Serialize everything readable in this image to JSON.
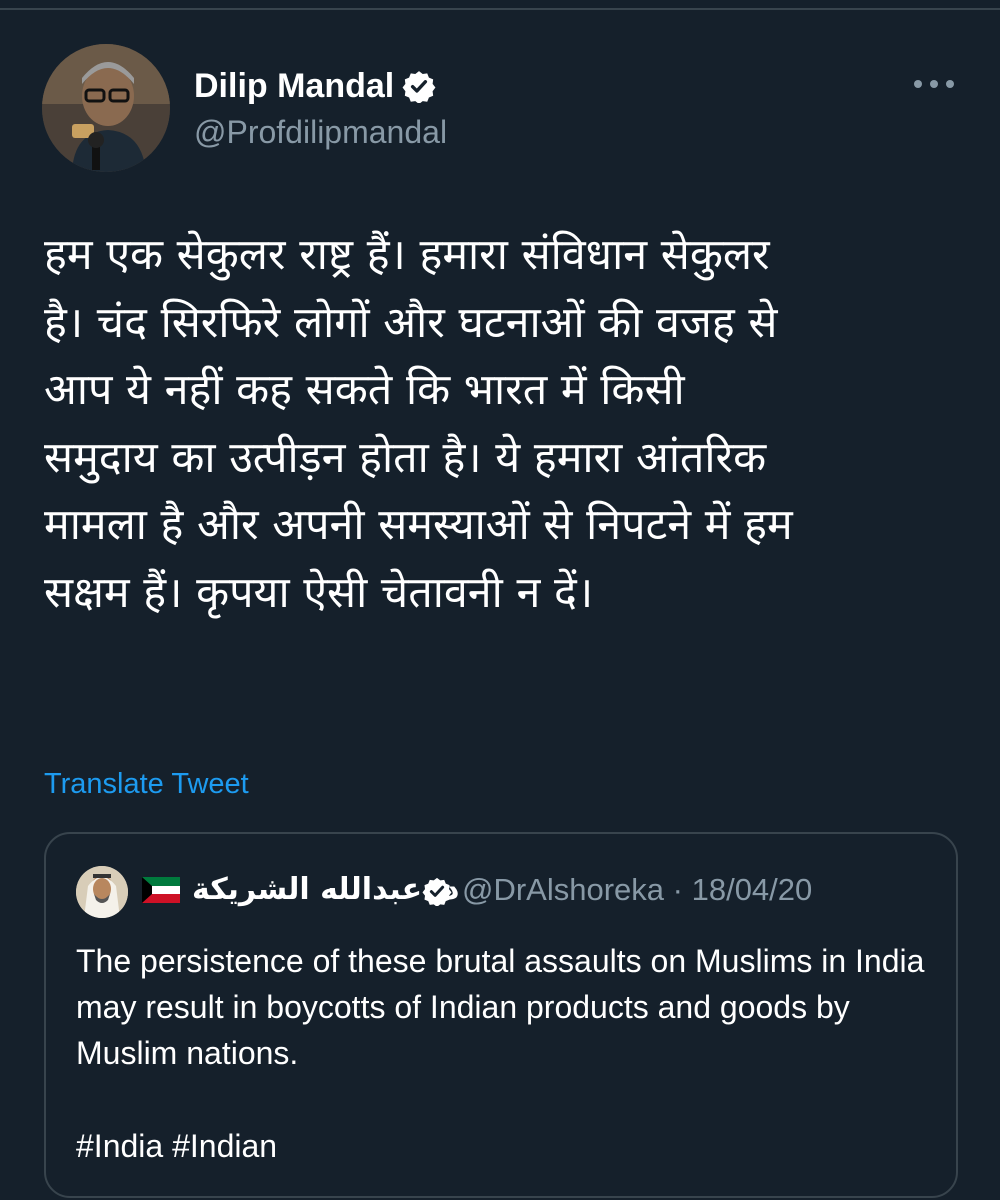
{
  "author": {
    "display_name": "Dilip Mandal",
    "handle": "@Profdilipmandal",
    "verified": true
  },
  "tweet": {
    "text": "हम एक सेकुलर राष्ट्र हैं। हमारा संविधान सेकुलर\nहै। चंद सिरफिरे लोगों और घटनाओं की वजह से\nआप ये नहीं कह सकते कि भारत में किसी\nसमुदाय का उत्पीड़न होता है। ये हमारा आंतरिक\nमामला है और अपनी समस्याओं से निपटने में हम\nसक्षम हैं। कृपया ऐसी चेतावनी न दें।",
    "translate_label": "Translate Tweet"
  },
  "quoted_tweet": {
    "display_name": "د. عبدالله الشريكة",
    "handle": "@DrAlshoreka",
    "separator": " · ",
    "date": "18/04/20",
    "verified": true,
    "flag": "kuwait-flag-icon",
    "text": "The persistence of these brutal assaults on Muslims in India may result in boycotts of Indian products and goods by Muslim nations.",
    "hashtags": "#India #Indian"
  },
  "colors": {
    "background": "#15202b",
    "border": "#38444d",
    "secondary_text": "#8899a6",
    "link": "#1d9bf0"
  }
}
